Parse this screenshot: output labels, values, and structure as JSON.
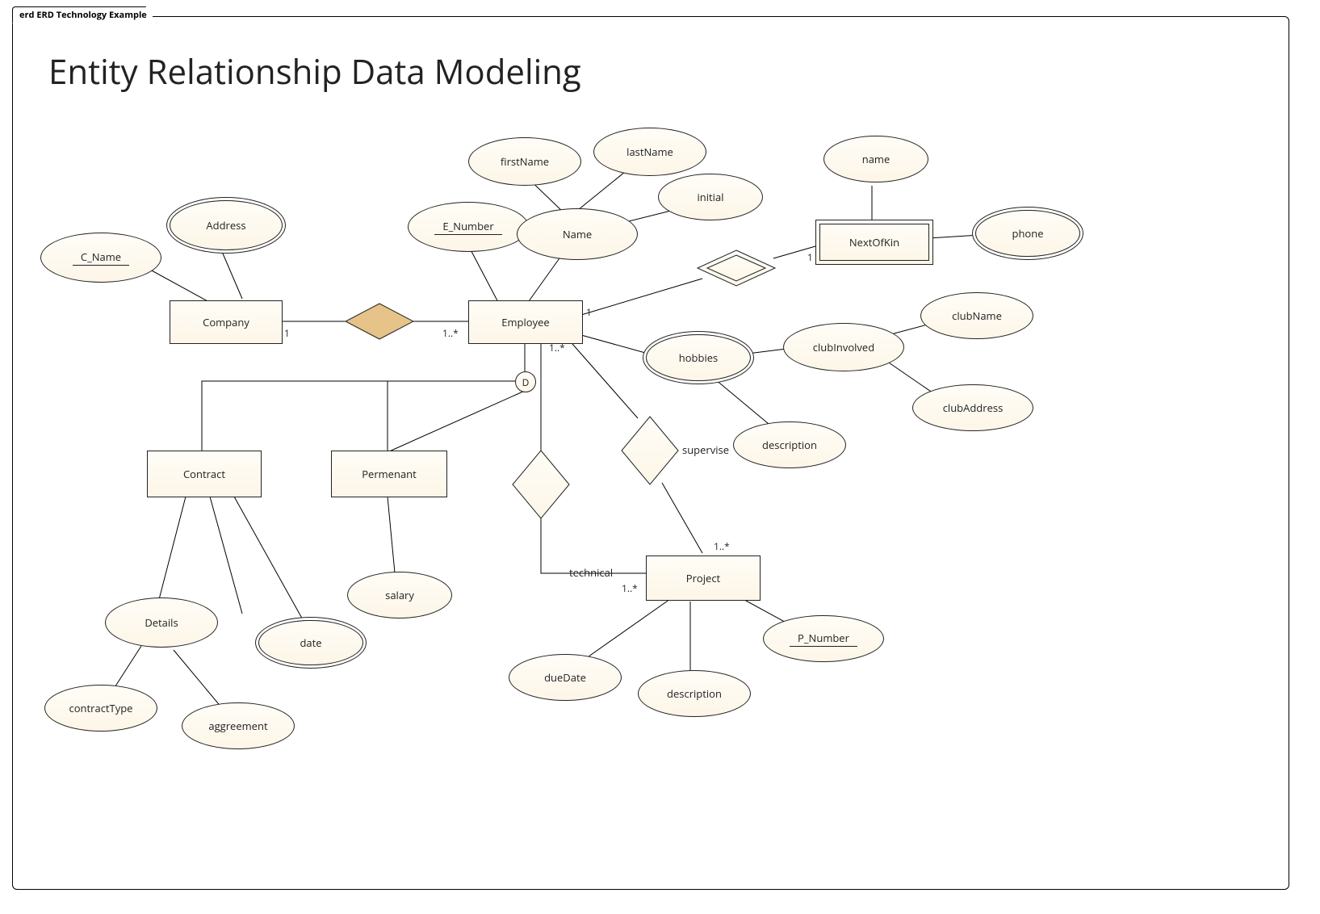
{
  "frame_tab": "erd ERD Technology Example",
  "title": "Entity Relationship Data Modeling",
  "entities": {
    "company": "Company",
    "employee": "Employee",
    "nextofkin": "NextOfKin",
    "contract": "Contract",
    "permanent": "Permenant",
    "project": "Project"
  },
  "attributes": {
    "c_name": "C_Name",
    "address": "Address",
    "e_number": "E_Number",
    "firstName": "firstName",
    "lastName": "lastName",
    "initial": "initial",
    "name_composite": "Name",
    "nok_name": "name",
    "nok_phone": "phone",
    "hobbies": "hobbies",
    "clubInvolved": "clubInvolved",
    "clubName": "clubName",
    "clubAddress": "clubAddress",
    "hobby_description": "description",
    "salary": "salary",
    "details": "Details",
    "contractType": "contractType",
    "aggreement": "aggreement",
    "date": "date",
    "dueDate": "dueDate",
    "proj_description": "description",
    "p_number": "P_Number"
  },
  "cardinalities": {
    "company_side": "1",
    "employee_company_side": "1..*",
    "employee_nok_side": "1",
    "nok_side": "1",
    "employee_project_side": "1..*",
    "project_tech_side": "1..*",
    "project_supervise_side": "1..*"
  },
  "roles": {
    "technical": "technical",
    "supervise": "supervise"
  },
  "disjoint": "D"
}
